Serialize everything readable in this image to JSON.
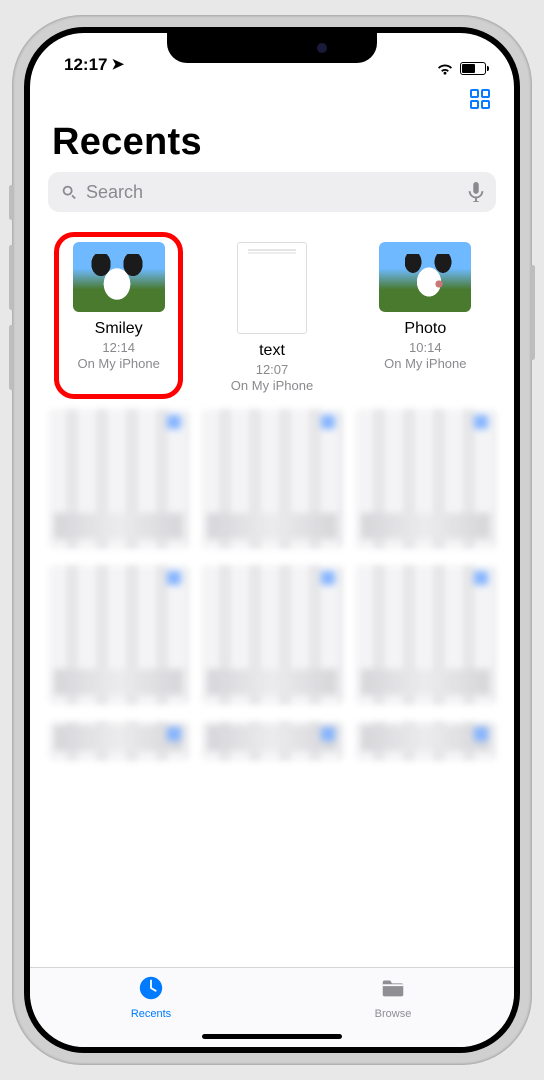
{
  "status": {
    "time": "12:17"
  },
  "header": {
    "title": "Recents"
  },
  "search": {
    "placeholder": "Search"
  },
  "files": [
    {
      "name": "Smiley",
      "time": "12:14",
      "location": "On My iPhone",
      "highlighted": true,
      "kind": "image"
    },
    {
      "name": "text",
      "time": "12:07",
      "location": "On My iPhone",
      "highlighted": false,
      "kind": "document"
    },
    {
      "name": "Photo",
      "time": "10:14",
      "location": "On My iPhone",
      "highlighted": false,
      "kind": "image"
    }
  ],
  "tabs": {
    "recents": "Recents",
    "browse": "Browse"
  }
}
